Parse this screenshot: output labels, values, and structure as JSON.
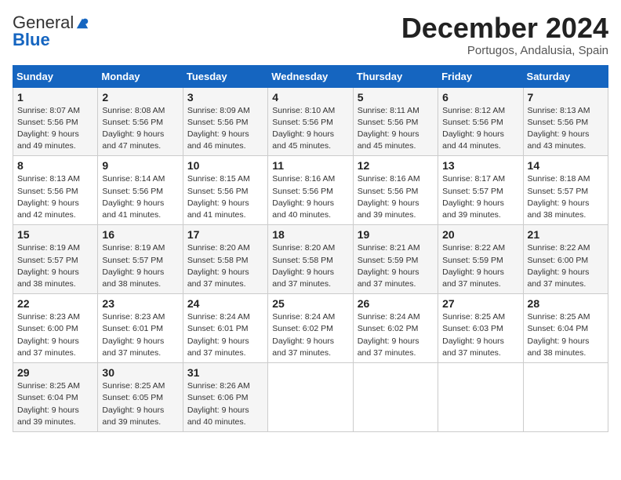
{
  "logo": {
    "general": "General",
    "blue": "Blue"
  },
  "title": "December 2024",
  "location": "Portugos, Andalusia, Spain",
  "headers": [
    "Sunday",
    "Monday",
    "Tuesday",
    "Wednesday",
    "Thursday",
    "Friday",
    "Saturday"
  ],
  "weeks": [
    [
      {
        "day": "1",
        "sunrise": "8:07 AM",
        "sunset": "5:56 PM",
        "daylight": "9 hours and 49 minutes."
      },
      {
        "day": "2",
        "sunrise": "8:08 AM",
        "sunset": "5:56 PM",
        "daylight": "9 hours and 47 minutes."
      },
      {
        "day": "3",
        "sunrise": "8:09 AM",
        "sunset": "5:56 PM",
        "daylight": "9 hours and 46 minutes."
      },
      {
        "day": "4",
        "sunrise": "8:10 AM",
        "sunset": "5:56 PM",
        "daylight": "9 hours and 45 minutes."
      },
      {
        "day": "5",
        "sunrise": "8:11 AM",
        "sunset": "5:56 PM",
        "daylight": "9 hours and 45 minutes."
      },
      {
        "day": "6",
        "sunrise": "8:12 AM",
        "sunset": "5:56 PM",
        "daylight": "9 hours and 44 minutes."
      },
      {
        "day": "7",
        "sunrise": "8:13 AM",
        "sunset": "5:56 PM",
        "daylight": "9 hours and 43 minutes."
      }
    ],
    [
      {
        "day": "8",
        "sunrise": "8:13 AM",
        "sunset": "5:56 PM",
        "daylight": "9 hours and 42 minutes."
      },
      {
        "day": "9",
        "sunrise": "8:14 AM",
        "sunset": "5:56 PM",
        "daylight": "9 hours and 41 minutes."
      },
      {
        "day": "10",
        "sunrise": "8:15 AM",
        "sunset": "5:56 PM",
        "daylight": "9 hours and 41 minutes."
      },
      {
        "day": "11",
        "sunrise": "8:16 AM",
        "sunset": "5:56 PM",
        "daylight": "9 hours and 40 minutes."
      },
      {
        "day": "12",
        "sunrise": "8:16 AM",
        "sunset": "5:56 PM",
        "daylight": "9 hours and 39 minutes."
      },
      {
        "day": "13",
        "sunrise": "8:17 AM",
        "sunset": "5:57 PM",
        "daylight": "9 hours and 39 minutes."
      },
      {
        "day": "14",
        "sunrise": "8:18 AM",
        "sunset": "5:57 PM",
        "daylight": "9 hours and 38 minutes."
      }
    ],
    [
      {
        "day": "15",
        "sunrise": "8:19 AM",
        "sunset": "5:57 PM",
        "daylight": "9 hours and 38 minutes."
      },
      {
        "day": "16",
        "sunrise": "8:19 AM",
        "sunset": "5:57 PM",
        "daylight": "9 hours and 38 minutes."
      },
      {
        "day": "17",
        "sunrise": "8:20 AM",
        "sunset": "5:58 PM",
        "daylight": "9 hours and 37 minutes."
      },
      {
        "day": "18",
        "sunrise": "8:20 AM",
        "sunset": "5:58 PM",
        "daylight": "9 hours and 37 minutes."
      },
      {
        "day": "19",
        "sunrise": "8:21 AM",
        "sunset": "5:59 PM",
        "daylight": "9 hours and 37 minutes."
      },
      {
        "day": "20",
        "sunrise": "8:22 AM",
        "sunset": "5:59 PM",
        "daylight": "9 hours and 37 minutes."
      },
      {
        "day": "21",
        "sunrise": "8:22 AM",
        "sunset": "6:00 PM",
        "daylight": "9 hours and 37 minutes."
      }
    ],
    [
      {
        "day": "22",
        "sunrise": "8:23 AM",
        "sunset": "6:00 PM",
        "daylight": "9 hours and 37 minutes."
      },
      {
        "day": "23",
        "sunrise": "8:23 AM",
        "sunset": "6:01 PM",
        "daylight": "9 hours and 37 minutes."
      },
      {
        "day": "24",
        "sunrise": "8:24 AM",
        "sunset": "6:01 PM",
        "daylight": "9 hours and 37 minutes."
      },
      {
        "day": "25",
        "sunrise": "8:24 AM",
        "sunset": "6:02 PM",
        "daylight": "9 hours and 37 minutes."
      },
      {
        "day": "26",
        "sunrise": "8:24 AM",
        "sunset": "6:02 PM",
        "daylight": "9 hours and 37 minutes."
      },
      {
        "day": "27",
        "sunrise": "8:25 AM",
        "sunset": "6:03 PM",
        "daylight": "9 hours and 37 minutes."
      },
      {
        "day": "28",
        "sunrise": "8:25 AM",
        "sunset": "6:04 PM",
        "daylight": "9 hours and 38 minutes."
      }
    ],
    [
      {
        "day": "29",
        "sunrise": "8:25 AM",
        "sunset": "6:04 PM",
        "daylight": "9 hours and 39 minutes."
      },
      {
        "day": "30",
        "sunrise": "8:25 AM",
        "sunset": "6:05 PM",
        "daylight": "9 hours and 39 minutes."
      },
      {
        "day": "31",
        "sunrise": "8:26 AM",
        "sunset": "6:06 PM",
        "daylight": "9 hours and 40 minutes."
      },
      null,
      null,
      null,
      null
    ]
  ]
}
